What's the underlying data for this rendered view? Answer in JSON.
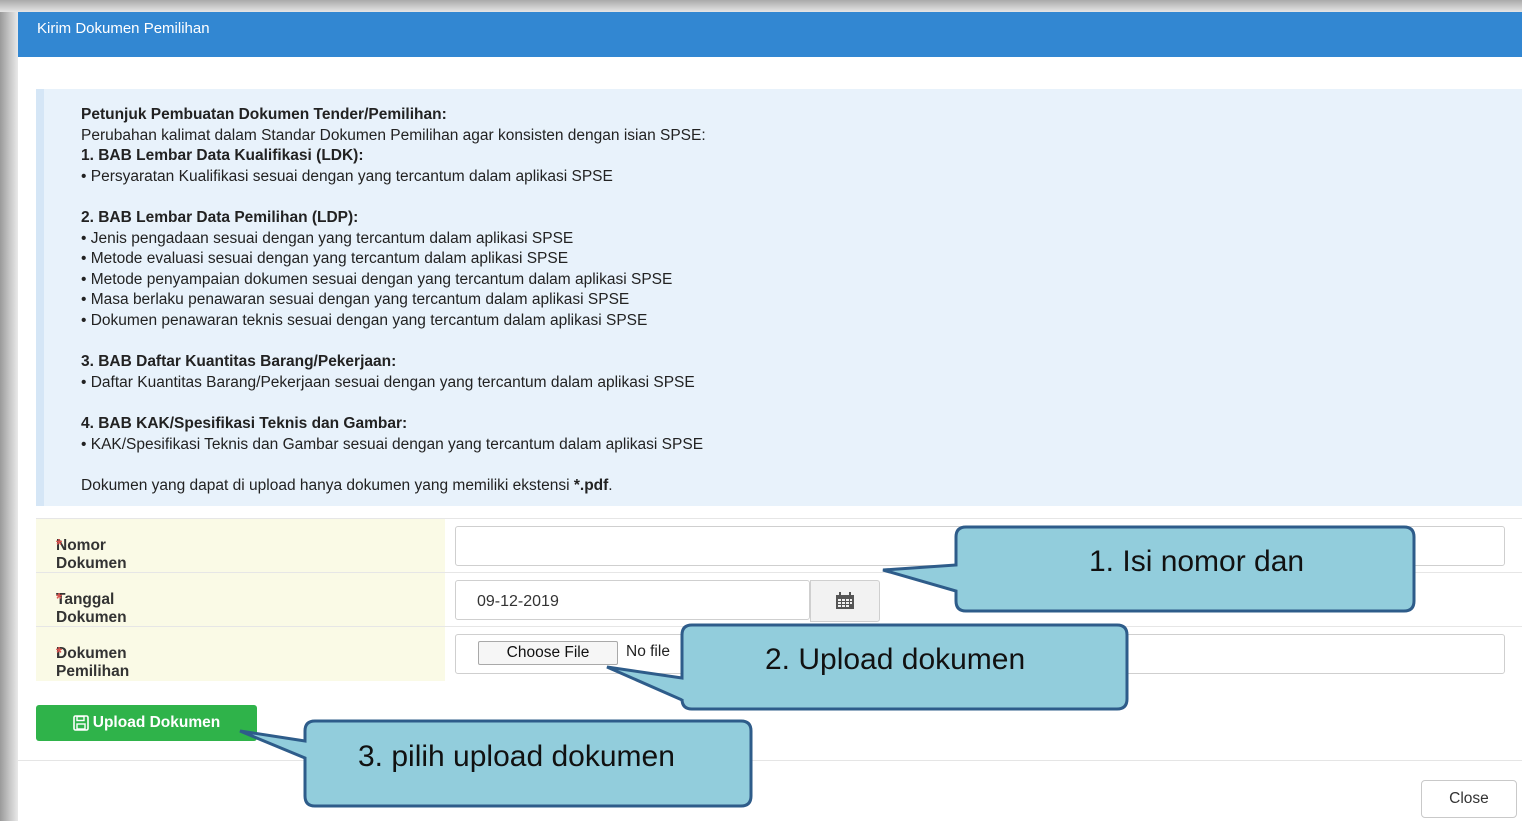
{
  "modal": {
    "title": "Kirim Dokumen Pemilihan"
  },
  "info": {
    "heading": "Petunjuk Pembuatan Dokumen Tender/Pemilihan:",
    "intro": "Perubahan kalimat dalam Standar Dokumen Pemilihan agar konsisten dengan isian SPSE:",
    "sections": [
      {
        "title": "1. BAB Lembar Data Kualifikasi (LDK):",
        "items": [
          "• Persyaratan Kualifikasi sesuai dengan yang tercantum dalam aplikasi SPSE"
        ]
      },
      {
        "title": "2. BAB Lembar Data Pemilihan (LDP):",
        "items": [
          "• Jenis pengadaan sesuai dengan yang tercantum dalam aplikasi SPSE",
          "• Metode evaluasi sesuai dengan yang tercantum dalam aplikasi SPSE",
          "• Metode penyampaian dokumen sesuai dengan yang tercantum dalam aplikasi SPSE",
          "• Masa berlaku penawaran sesuai dengan yang tercantum dalam aplikasi SPSE",
          "• Dokumen penawaran teknis sesuai dengan yang tercantum dalam aplikasi SPSE"
        ]
      },
      {
        "title": "3. BAB Daftar Kuantitas Barang/Pekerjaan:",
        "items": [
          "• Daftar Kuantitas Barang/Pekerjaan sesuai dengan yang tercantum dalam aplikasi SPSE"
        ]
      },
      {
        "title": "4. BAB KAK/Spesifikasi Teknis dan Gambar:",
        "items": [
          "• KAK/Spesifikasi Teknis dan Gambar sesuai dengan yang tercantum dalam aplikasi SPSE"
        ]
      }
    ],
    "note_prefix": "Dokumen yang dapat di upload hanya dokumen yang memiliki ekstensi ",
    "note_ext": "*.pdf",
    "note_suffix": "."
  },
  "form": {
    "nomor_label": "Nomor Dokumen Pemilihan",
    "tanggal_label": "Tanggal Dokumen Pemilihan",
    "dokumen_label": "Dokumen Pemilihan",
    "required_mark": "*",
    "nomor_value": "",
    "tanggal_value": "09-12-2019",
    "choose_file_label": "Choose File",
    "no_file_text": "No file"
  },
  "buttons": {
    "upload_label": "Upload Dokumen",
    "close_label": "Close"
  },
  "callouts": {
    "one": "1.  Isi nomor dan",
    "two": "2. Upload dokumen",
    "three": "3. pilih upload dokumen"
  },
  "colors": {
    "header": "#3287d2",
    "callout_fill": "#92cddc",
    "callout_stroke": "#2e5c8a",
    "upload_button": "#2fb34a"
  },
  "icons": {
    "calendar": "calendar-icon",
    "save": "floppy-icon"
  }
}
